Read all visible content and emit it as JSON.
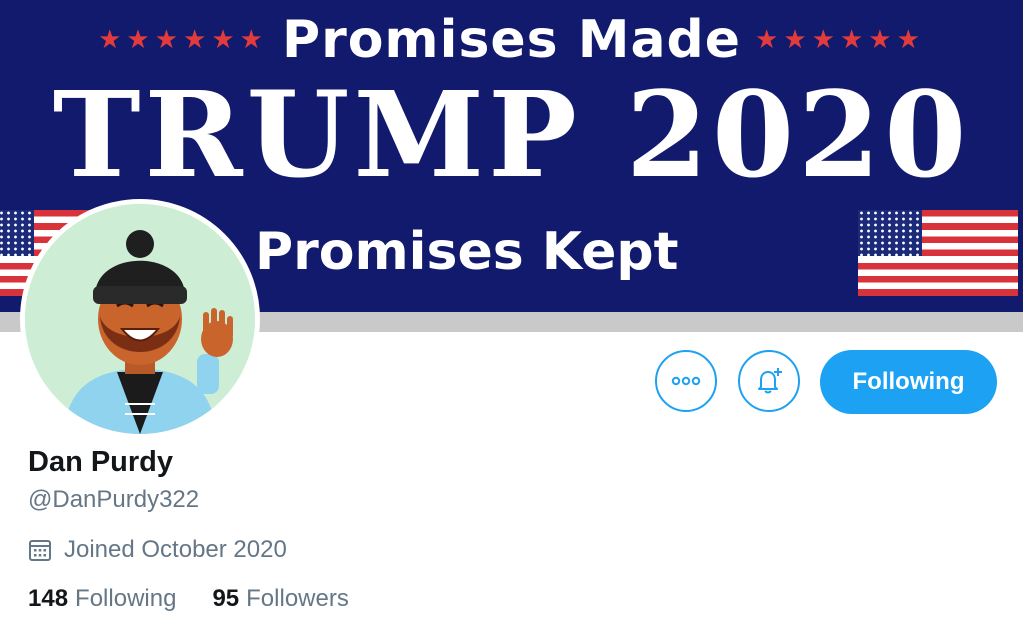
{
  "banner": {
    "top_line": "Promises Made",
    "main_line": "TRUMP 2020",
    "bottom_line": "Promises Kept",
    "stars_left": "★★★★★★",
    "stars_right": "★★★★★★"
  },
  "profile": {
    "display_name": "Dan Purdy",
    "handle": "@DanPurdy322",
    "joined": "Joined October 2020"
  },
  "actions": {
    "follow_label": "Following"
  },
  "stats": {
    "following_count": "148",
    "following_label": "Following",
    "followers_count": "95",
    "followers_label": "Followers"
  },
  "icons": {
    "more": "more-icon",
    "notify": "bell-plus-icon",
    "calendar": "calendar-icon"
  },
  "colors": {
    "accent": "#1da1f2",
    "banner_blue": "#121a6e",
    "text_primary": "#14171a",
    "text_secondary": "#657786"
  }
}
